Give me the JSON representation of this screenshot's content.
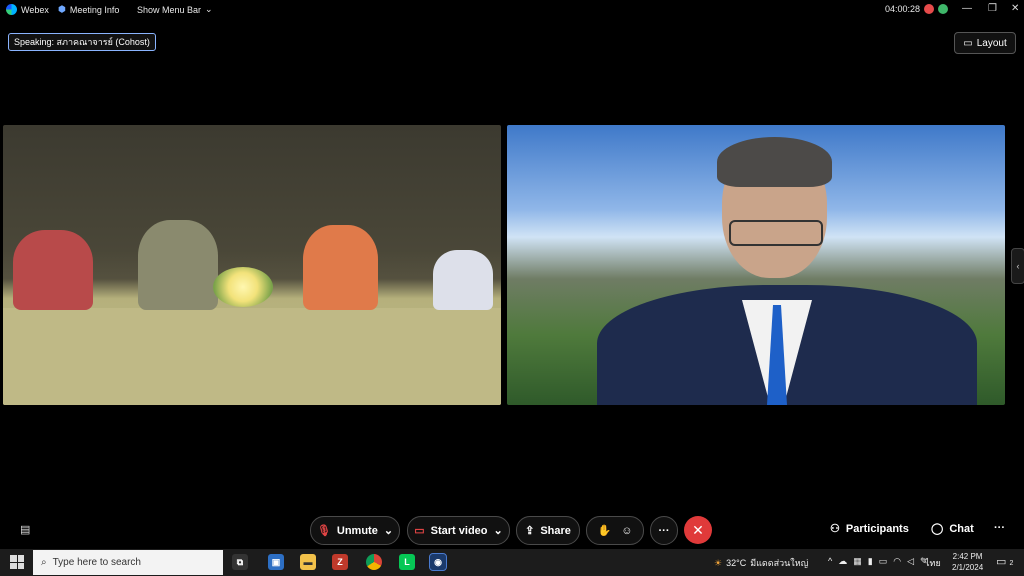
{
  "topbar": {
    "app_name": "Webex",
    "meeting_info": "Meeting Info",
    "show_menu_bar": "Show Menu Bar",
    "timer": "04:00:28"
  },
  "speaking": {
    "label": "Speaking: สภาคณาจารย์ (Cohost)"
  },
  "layout": {
    "label": "Layout"
  },
  "controls": {
    "unmute": "Unmute",
    "start_video": "Start video",
    "share": "Share",
    "more": "···",
    "participants": "Participants",
    "chat": "Chat",
    "overflow": "···"
  },
  "taskbar": {
    "search_placeholder": "Type here to search",
    "weather_temp": "32°C",
    "weather_desc": "มีแดดส่วนใหญ่",
    "lang": "ไทย",
    "time": "2:42 PM",
    "date": "2/1/2024",
    "notification_count": "2"
  },
  "colors": {
    "end_call": "#e03a3a",
    "mute_red": "#e04444",
    "speaking_border": "#8ab4ff"
  }
}
